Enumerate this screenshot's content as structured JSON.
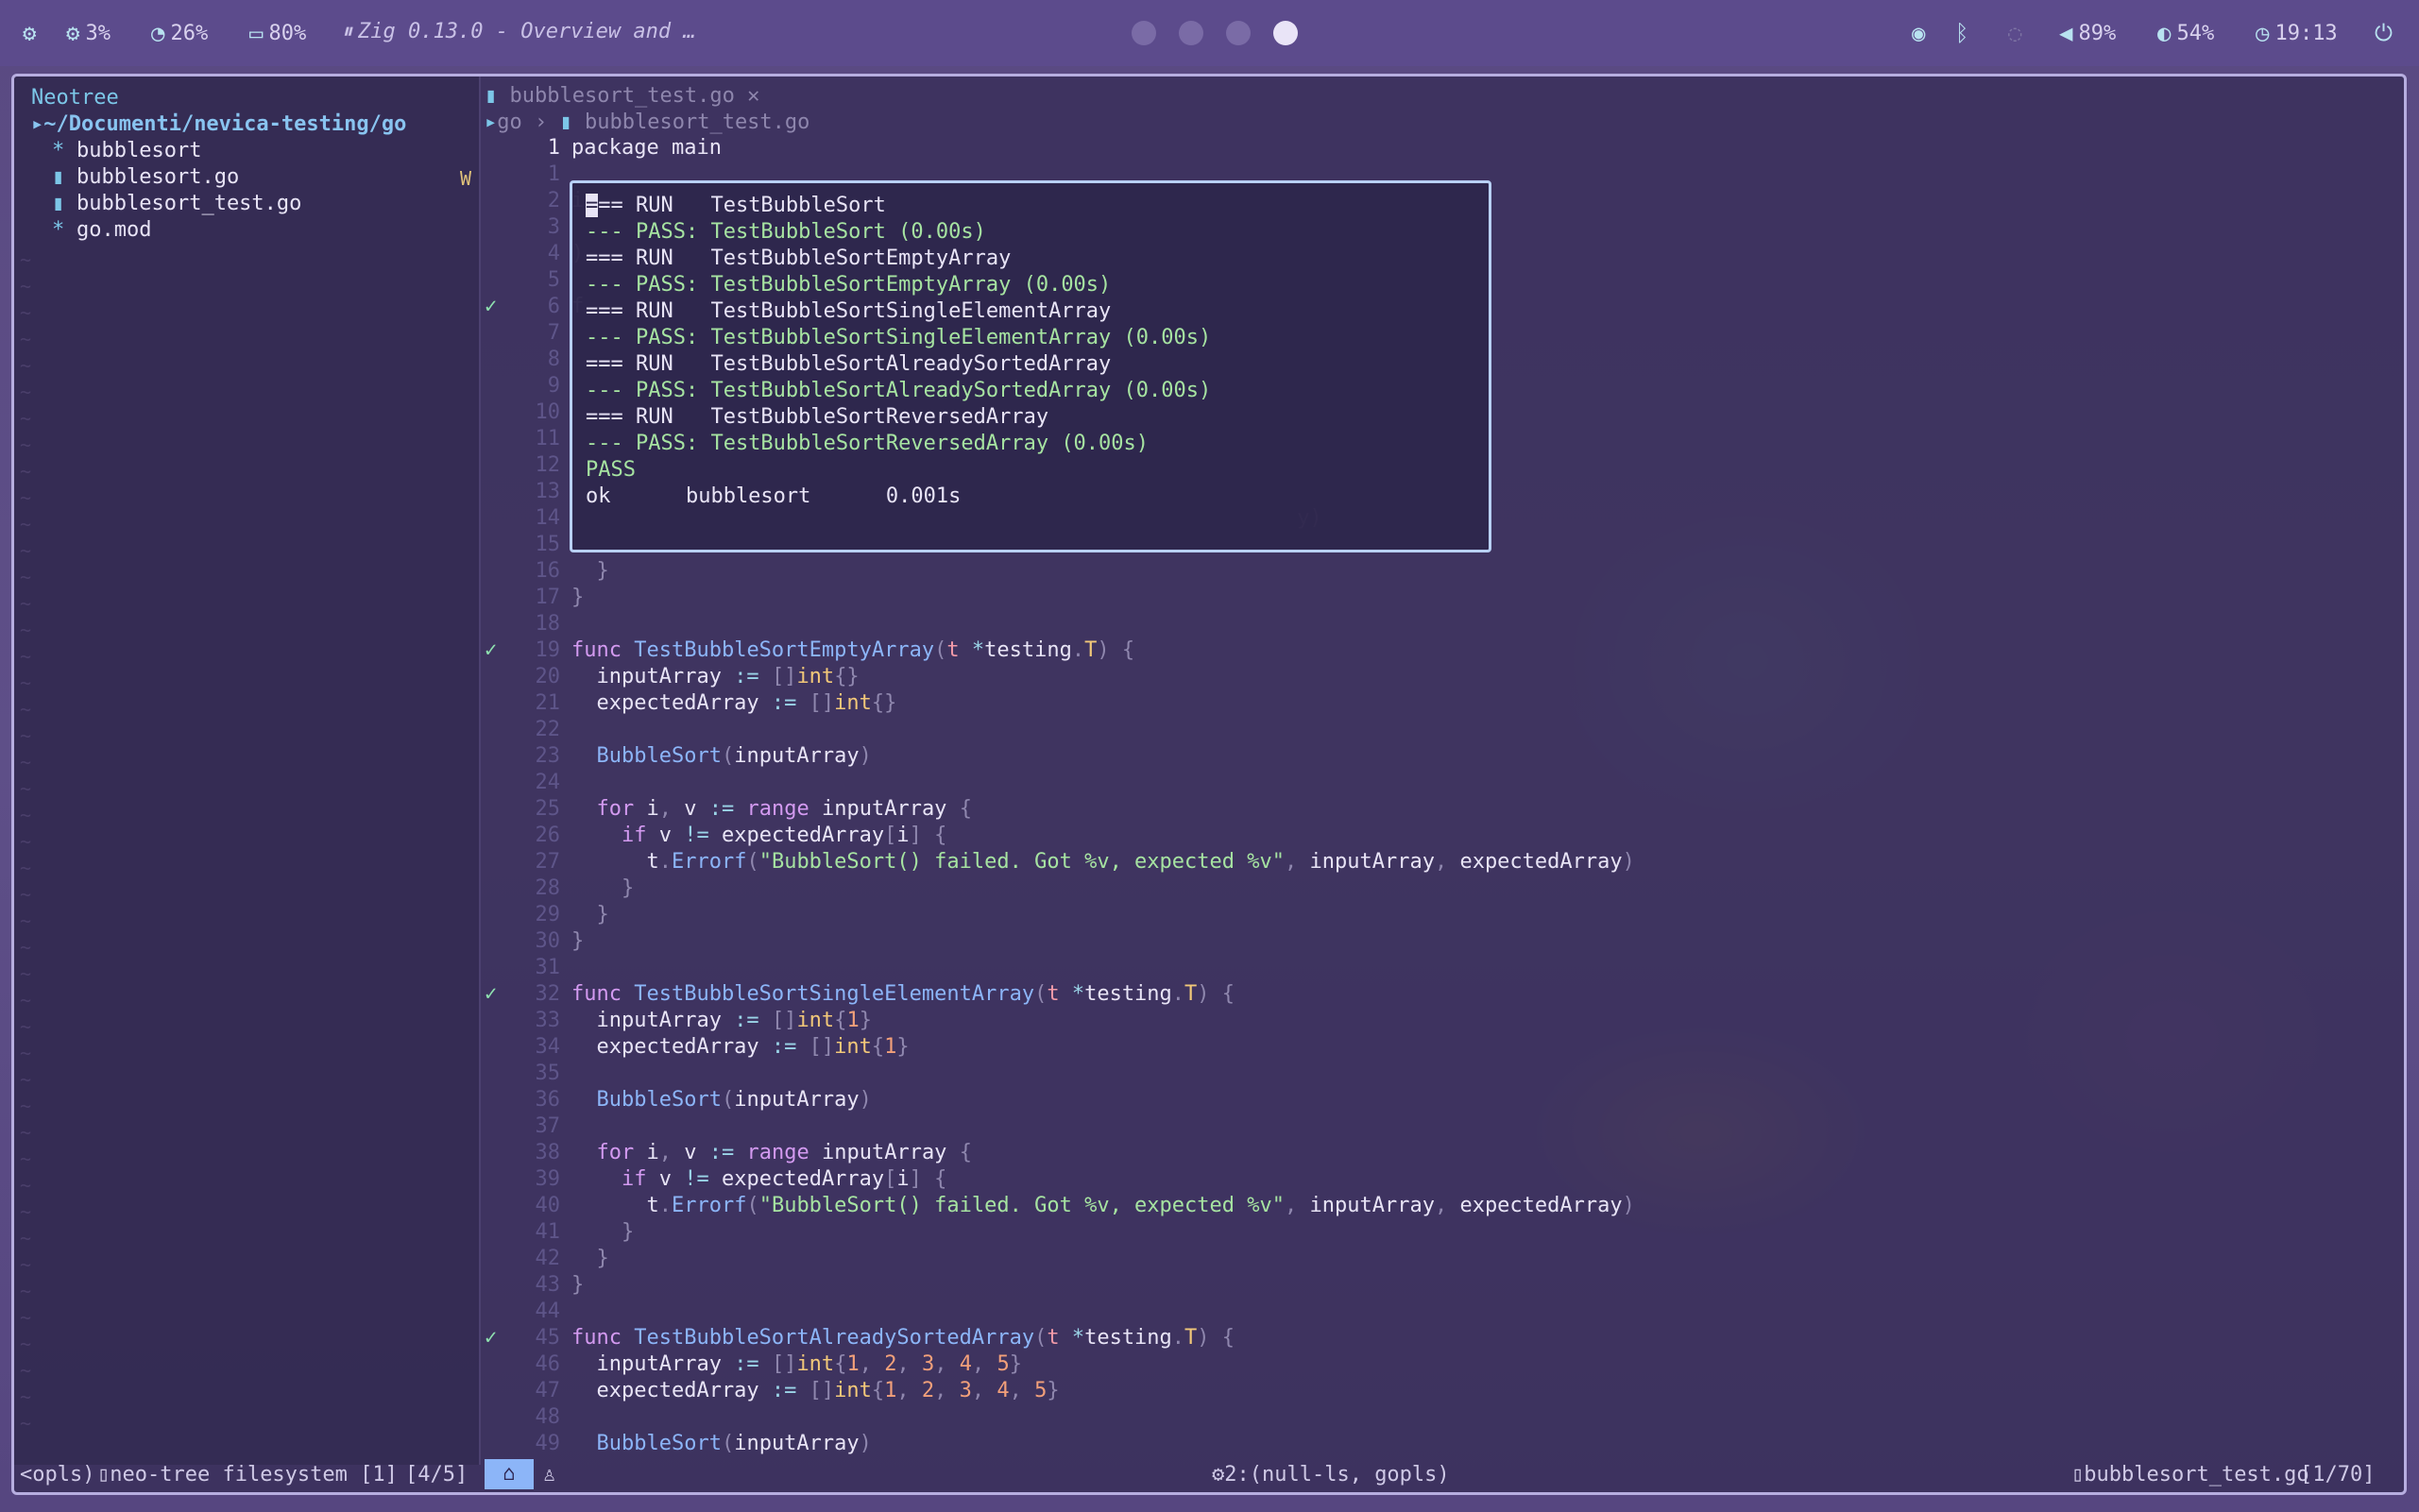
{
  "topbar": {
    "cpu": "3%",
    "mem": "26%",
    "battery": "80%",
    "title": "Zig 0.13.0 - Overview and …",
    "volume": "89%",
    "brightness": "54%",
    "time": "19:13"
  },
  "neotree": {
    "title": "Neotree",
    "root": "~/Documenti/nevica-testing/go",
    "items": [
      "bubblesort",
      "bubblesort.go",
      "bubblesort_test.go",
      "go.mod"
    ],
    "modified_flag": "W"
  },
  "editor": {
    "tab": "bubblesort_test.go",
    "tab_close": "✕",
    "breadcrumb_dir": "go",
    "breadcrumb_file": "bubblesort_test.go"
  },
  "test_output": [
    "=== RUN   TestBubbleSort",
    "--- PASS: TestBubbleSort (0.00s)",
    "=== RUN   TestBubbleSortEmptyArray",
    "--- PASS: TestBubbleSortEmptyArray (0.00s)",
    "=== RUN   TestBubbleSortSingleElementArray",
    "--- PASS: TestBubbleSortSingleElementArray (0.00s)",
    "=== RUN   TestBubbleSortAlreadySortedArray",
    "--- PASS: TestBubbleSortAlreadySortedArray (0.00s)",
    "=== RUN   TestBubbleSortReversedArray",
    "--- PASS: TestBubbleSortReversedArray (0.00s)",
    "PASS",
    "ok      bubblesort      0.001s"
  ],
  "statusline": {
    "left_mode": "<opls)",
    "neotree_label": "neo-tree filesystem [1]",
    "position": "[4/5]",
    "lsp": "2:(null-ls, gopls)",
    "file": "bubblesort_test.go",
    "file_position": "[1/70]"
  }
}
